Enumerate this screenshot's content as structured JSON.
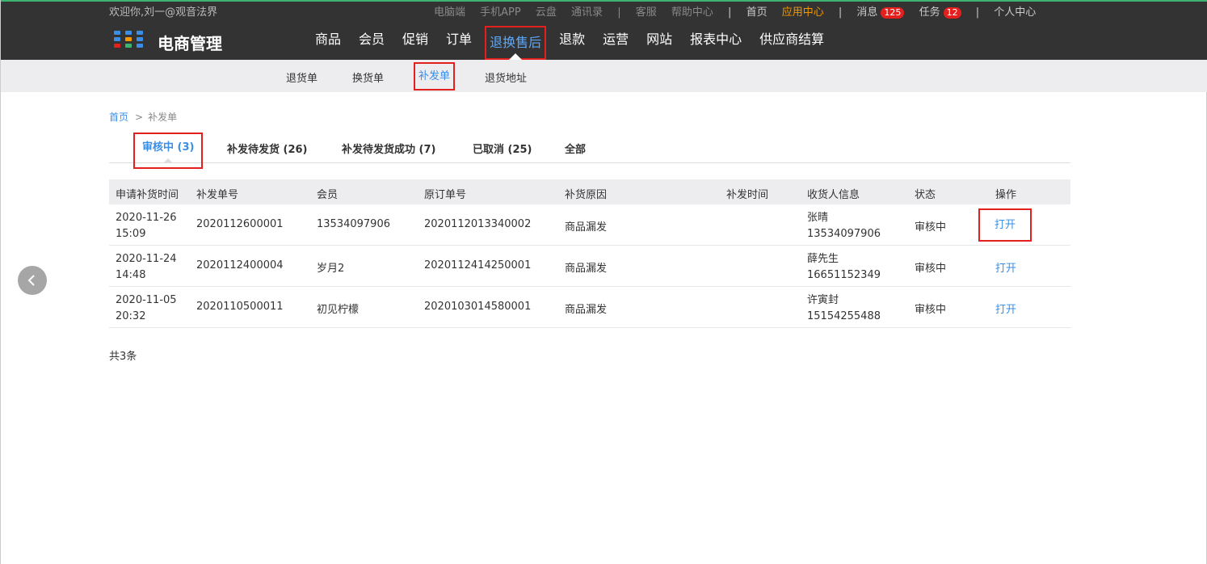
{
  "topbar": {
    "welcome": "欢迎你,刘一@观音法界",
    "links": [
      "电脑端",
      "手机APP",
      "云盘",
      "通讯录"
    ],
    "service": [
      "客服",
      "帮助中心"
    ],
    "home": "首页",
    "app_center": "应用中心",
    "messages": "消息",
    "messages_count": "125",
    "tasks": "任务",
    "tasks_count": "12",
    "personal": "个人中心"
  },
  "header": {
    "logo_text": "电商管理",
    "nav": [
      "商品",
      "会员",
      "促销",
      "订单",
      "退换售后",
      "退款",
      "运营",
      "网站",
      "报表中心",
      "供应商结算"
    ]
  },
  "subnav": [
    "退货单",
    "换货单",
    "补发单",
    "退货地址"
  ],
  "breadcrumb": {
    "home": "首页",
    "sep": ">",
    "current": "补发单"
  },
  "tabs": [
    "审核中 (3)",
    "补发待发货 (26)",
    "补发待发货成功 (7)",
    "已取消 (25)",
    "全部"
  ],
  "table": {
    "headers": [
      "申请补货时间",
      "补发单号",
      "会员",
      "原订单号",
      "补货原因",
      "补发时间",
      "收货人信息",
      "状态",
      "操作"
    ],
    "rows": [
      {
        "date": "2020-11-26",
        "time": "15:09",
        "no": "2020112600001",
        "member": "13534097906",
        "order": "2020112013340002",
        "reason": "商品漏发",
        "ship_time": "",
        "name": "张晴",
        "phone": "13534097906",
        "status": "审核中",
        "op": "打开"
      },
      {
        "date": "2020-11-24",
        "time": "14:48",
        "no": "2020112400004",
        "member": "岁月2",
        "order": "2020112414250001",
        "reason": "商品漏发",
        "ship_time": "",
        "name": "薛先生",
        "phone": "16651152349",
        "status": "审核中",
        "op": "打开"
      },
      {
        "date": "2020-11-05",
        "time": "20:32",
        "no": "2020110500011",
        "member": "初见柠檬",
        "order": "2020103014580001",
        "reason": "商品漏发",
        "ship_time": "",
        "name": "许寅封",
        "phone": "15154255488",
        "status": "审核中",
        "op": "打开"
      }
    ]
  },
  "total": "共3条"
}
